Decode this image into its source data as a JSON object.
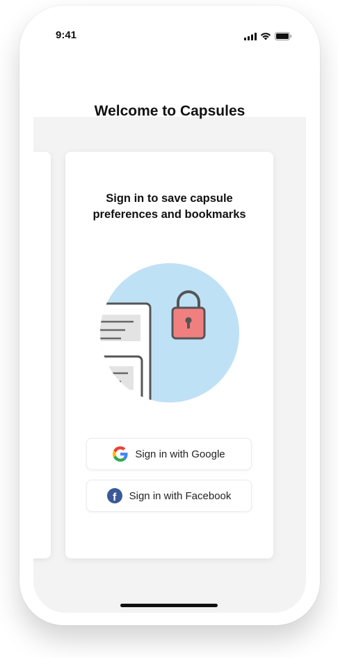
{
  "status_bar": {
    "time": "9:41",
    "icons": [
      "signal-icon",
      "wifi-icon",
      "battery-icon"
    ]
  },
  "page": {
    "title": "Welcome to Capsules"
  },
  "card": {
    "heading": "Sign in to save capsule preferences and bookmarks",
    "illustration": "documents-and-lock",
    "buttons": [
      {
        "label": "Sign in with Google",
        "icon": "google-icon"
      },
      {
        "label": "Sign in with Facebook",
        "icon": "facebook-icon"
      }
    ]
  },
  "colors": {
    "illustration_bg": "#bfe1f6",
    "lock": "#f08080",
    "facebook": "#3b5998"
  }
}
